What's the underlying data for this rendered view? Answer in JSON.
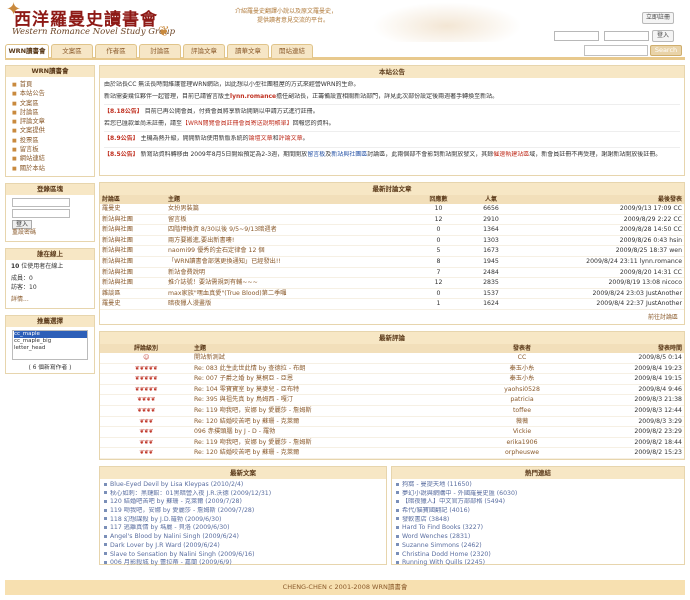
{
  "header": {
    "logo_cn": "西洋羅曼史讀書會",
    "logo_en": "Western Romance Novel Study Group",
    "slogan_line1": "介紹羅曼史翻譯小說以及原文羅曼史，",
    "slogan_line2": "提供讀者意見交流的平台。",
    "register_label": "立即註冊",
    "login_label": "登入"
  },
  "tabs": [
    {
      "label": "WRN讀書會",
      "active": true
    },
    {
      "label": "文案區",
      "active": false
    },
    {
      "label": "作者區",
      "active": false
    },
    {
      "label": "討論區",
      "active": false
    },
    {
      "label": "評論文章",
      "active": false
    },
    {
      "label": "讀華文章",
      "active": false
    },
    {
      "label": "開站連結",
      "active": false
    }
  ],
  "search": {
    "button_label": "Search"
  },
  "sidebar": {
    "nav_title": "WRN讀書會",
    "nav_items": [
      "首頁",
      "本站公告",
      "文案區",
      "討論區",
      "評論文章",
      "文案提供",
      "投票區",
      "留言板",
      "網站連結",
      "關於本站"
    ],
    "login_title": "登錄區塊",
    "login_button": "登入",
    "forgot_label": "重設密碼",
    "online_title": "誰在線上",
    "online_count": "10",
    "online_text": "位使用者在線上",
    "members_label": "成員：0",
    "guests_label": "訪客：10",
    "detail_label": "詳情...",
    "top_title": "推薦選擇",
    "top_list": [
      "cc_maple",
      "cc_maple_big",
      "letter_head"
    ],
    "top_count": "( 6 個新寫作者 )"
  },
  "announcement": {
    "title": "本站公告",
    "intro": "由於站長CC 無法長時間維護管理WRN網站，因此想以小型社團租屋的方式來經營WRN的生命。",
    "line2_a": "新站需要幾位夥伴一起管理，目前已請留言版主",
    "line2_b": "lynn.romance",
    "line2_c": "擔任副站長，正籌備設置相關新站部門，詳見此次部份設定後兩週著手轉換至新站。",
    "n1_tag": "【8.18公告】",
    "n1_text": "目前已再公開會員，付費會員將享新站開銷以申請方式進行註冊。",
    "n1_text2": "若您已匯款並尚未註冊，請至",
    "n1_link": "【WRN閱覽會員註冊會員寄送說明帳單】",
    "n1_text3": "回報您的資料。",
    "n2_tag": "【8.9公告】",
    "n2_text": "主機為熱升級，開開新站使用新版系統的",
    "n2_link": "論壇文章",
    "n2_text2": "和",
    "n2_link2": "評論文章",
    "n2_text3": "。",
    "n3_tag": "【8.5公告】",
    "n3_text": "新寫站資料轉移由 2009年8月5日開始預定為2-3週，期間開放",
    "n3_link1": "留言板",
    "n3_text2": "及",
    "n3_link2": "新站與社團區",
    "n3_text3": "討論區，此兩個部不會影到新站開放發文，其餘",
    "n3_link3": "催速執建站區",
    "n3_text4": "域，新會員註冊不再受理，謝謝新站開放後註冊。"
  },
  "latest_topics": {
    "title": "最新討論文章",
    "headers": [
      "討論區",
      "主題",
      "回應數",
      "人氣",
      "最後發表"
    ],
    "rows": [
      {
        "cat": "羅曼史",
        "topic": "女扮男裝篇",
        "replies": "10",
        "views": "6656",
        "last": "2009/9/13 17:09 CC"
      },
      {
        "cat": "新站與社團",
        "topic": "留言板",
        "replies": "12",
        "views": "2910",
        "last": "2009/8/29 2:22 CC"
      },
      {
        "cat": "新站與社團",
        "topic": "四階押換資 8/30以後 9/5~9/13暗週者",
        "replies": "0",
        "views": "1364",
        "last": "2009/8/28 14:50 CC"
      },
      {
        "cat": "新站與社團",
        "topic": "兩方要搬進,要出新書嘍!",
        "replies": "0",
        "views": "1303",
        "last": "2009/8/26 0:43 hsin"
      },
      {
        "cat": "新站與社團",
        "topic": "naomi99 優秀的金石定律會 12 個",
        "replies": "5",
        "views": "1673",
        "last": "2009/8/25 18:37 wen"
      },
      {
        "cat": "新站與社團",
        "topic": "「WRN讀書會部落更換通知」已經發出!!",
        "replies": "8",
        "views": "1945",
        "last": "2009/8/24 23:11 lynn.romance"
      },
      {
        "cat": "新站與社團",
        "topic": "新站會費說明",
        "replies": "7",
        "views": "2484",
        "last": "2009/8/20 14:31 CC"
      },
      {
        "cat": "新站與社團",
        "topic": "推介誌號！要站需規到有輔~~~",
        "replies": "12",
        "views": "2835",
        "last": "2009/8/19 13:08 nicoco"
      },
      {
        "cat": "雜談區",
        "topic": "max家族\"嘿血真愛\"(True Blood)第二季囉",
        "replies": "0",
        "views": "1537",
        "last": "2009/8/24 23:03 JustAnother"
      },
      {
        "cat": "羅曼史",
        "topic": "暗夜獵人漫畫版",
        "replies": "1",
        "views": "1624",
        "last": "2009/8/4 22:37 JustAnother"
      }
    ],
    "more": "前往討論區"
  },
  "latest_reviews": {
    "title": "最新評論",
    "headers": [
      "評論級別",
      "主題",
      "發表者",
      "發表時間"
    ],
    "rows": [
      {
        "rating": 0,
        "topic": "開站新測試",
        "author": "CC",
        "time": "2009/8/5 0:14"
      },
      {
        "rating": 5,
        "topic": "Re: 083 此生此世此情 by 查德拉 - 布朗",
        "author": "秦玉小糸",
        "time": "2009/8/4 19:23"
      },
      {
        "rating": 5,
        "topic": "Re: 007 子爵之婚 by 莫桐亞 - 亞恩",
        "author": "秦玉小糸",
        "time": "2009/8/4 19:15"
      },
      {
        "rating": 5,
        "topic": "Re: 104 零寶寶室 by 莫麥兒 - 亞布特",
        "author": "yaohsi0528",
        "time": "2009/8/4 9:46"
      },
      {
        "rating": 4,
        "topic": "Re: 395 與祖先真 by 鳥姆西 - 嘎汀",
        "author": "patricia",
        "time": "2009/8/3 21:38"
      },
      {
        "rating": 4,
        "topic": "Re: 119 吻我吧，安娜 by 愛麗莎 - 詹姆斯",
        "author": "toffee",
        "time": "2009/8/3 12:44"
      },
      {
        "rating": 3,
        "topic": "Re: 120 結婚咬苦吧 by 蘇珊 - 克萊爾",
        "author": "薇薇",
        "time": "2009/8/3 3:29"
      },
      {
        "rating": 3,
        "topic": "096 赤撲頭腦 by J - D - 羅勃",
        "author": "Vickie",
        "time": "2009/8/2 23:29"
      },
      {
        "rating": 3,
        "topic": "Re: 119 吻我吧，安娜 by 愛麗莎 - 詹姆斯",
        "author": "erika1906",
        "time": "2009/8/2 18:44"
      },
      {
        "rating": 3,
        "topic": "Re: 120 結婚咬苦吧 by 蘇珊 - 克萊爾",
        "author": "orpheuswe",
        "time": "2009/8/2 15:23"
      }
    ]
  },
  "latest_books": {
    "title": "最新文案",
    "items": [
      "Blue-Eyed Devil by Lisa Kleypas (2010/2/4)",
      "秋心如刺：黑鏈館：01黑暗營入夜 J.R.沃德 (2009/12/31)",
      "120 結婚吧苦吧 by 蘇珊 - 克萊爾 (2009/7/28)",
      "119 吻我吧，安娜 by 愛麗莎 - 詹姆斯 (2009/7/28)",
      "118 幻想謀殺 by J.D.羅勃 (2009/6/30)",
      "117 逃離真情 by 瑪麗 - 貝洛 (2009/6/30)",
      "Angel's Blood by Nalini Singh (2009/6/24)",
      "Dark Lover by J.R Ward (2009/6/24)",
      "Slave to Sensation by Nalini Singh (2009/6/16)",
      "006 月影殺城 by 蕾拉蒂 - 嘉蘭 (2009/6/9)"
    ]
  },
  "hot_links": {
    "title": "熱門連結",
    "items": [
      "狗窩 - 曼提天地 (11650)",
      "夢幻小說與網購中 - 外國羅曼史匯 (6030)",
      "【暗夜獵人】中文官方部部格 (5494)",
      "希代/貓寶國翻記 (4016)",
      "發軟書店 (3848)",
      "Hard To Find Books (3227)",
      "Word Wenches (2831)",
      "Suzanne Simmons (2462)",
      "Christina Dodd Home (2320)",
      "Running With Quills (2245)"
    ]
  },
  "footer": {
    "text": "CHENG-CHEN c 2001-2008 WRN讀書會"
  },
  "colors": {
    "accent": "#f7e7c5",
    "border": "#e7d5ad",
    "brand_red": "#8e1a16",
    "link": "#8a5a2b",
    "rating_red": "#c0392b"
  }
}
